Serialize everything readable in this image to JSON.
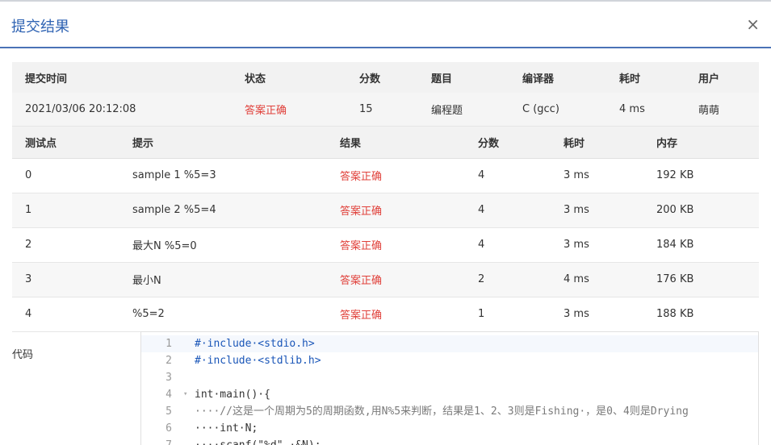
{
  "modal": {
    "title": "提交结果",
    "close_icon": "×"
  },
  "summary": {
    "headers": [
      "提交时间",
      "状态",
      "分数",
      "题目",
      "编译器",
      "耗时",
      "用户"
    ],
    "row": {
      "time": "2021/03/06 20:12:08",
      "status": "答案正确",
      "score": "15",
      "problem": "编程题",
      "compiler": "C (gcc)",
      "elapsed": "4 ms",
      "user": "萌萌"
    }
  },
  "cases": {
    "headers": [
      "测试点",
      "提示",
      "结果",
      "分数",
      "耗时",
      "内存"
    ],
    "rows": [
      {
        "id": "0",
        "hint": "sample 1 %5=3",
        "result": "答案正确",
        "score": "4",
        "time": "3 ms",
        "memory": "192 KB"
      },
      {
        "id": "1",
        "hint": "sample 2 %5=4",
        "result": "答案正确",
        "score": "4",
        "time": "3 ms",
        "memory": "200 KB"
      },
      {
        "id": "2",
        "hint": "最大N %5=0",
        "result": "答案正确",
        "score": "4",
        "time": "3 ms",
        "memory": "184 KB"
      },
      {
        "id": "3",
        "hint": "最小N",
        "result": "答案正确",
        "score": "2",
        "time": "4 ms",
        "memory": "176 KB"
      },
      {
        "id": "4",
        "hint": "%5=2",
        "result": "答案正确",
        "score": "1",
        "time": "3 ms",
        "memory": "188 KB"
      }
    ]
  },
  "code": {
    "label": "代码",
    "lines": [
      {
        "n": "1",
        "text": "#·include·<stdio.h>",
        "kind": "pp"
      },
      {
        "n": "2",
        "text": "#·include·<stdlib.h>",
        "kind": "pp"
      },
      {
        "n": "3",
        "text": "",
        "kind": ""
      },
      {
        "n": "4",
        "text": "int·main()·{",
        "kind": "",
        "fold": "▾"
      },
      {
        "n": "5",
        "text": "····//这是一个周期为5的周期函数,用N%5来判断，结果是1、2、3则是Fishing·，是0、4则是Drying",
        "kind": "cm"
      },
      {
        "n": "6",
        "text": "····int·N;",
        "kind": ""
      },
      {
        "n": "7",
        "text": "····scanf(\"%d\",·&N);",
        "kind": ""
      }
    ]
  }
}
